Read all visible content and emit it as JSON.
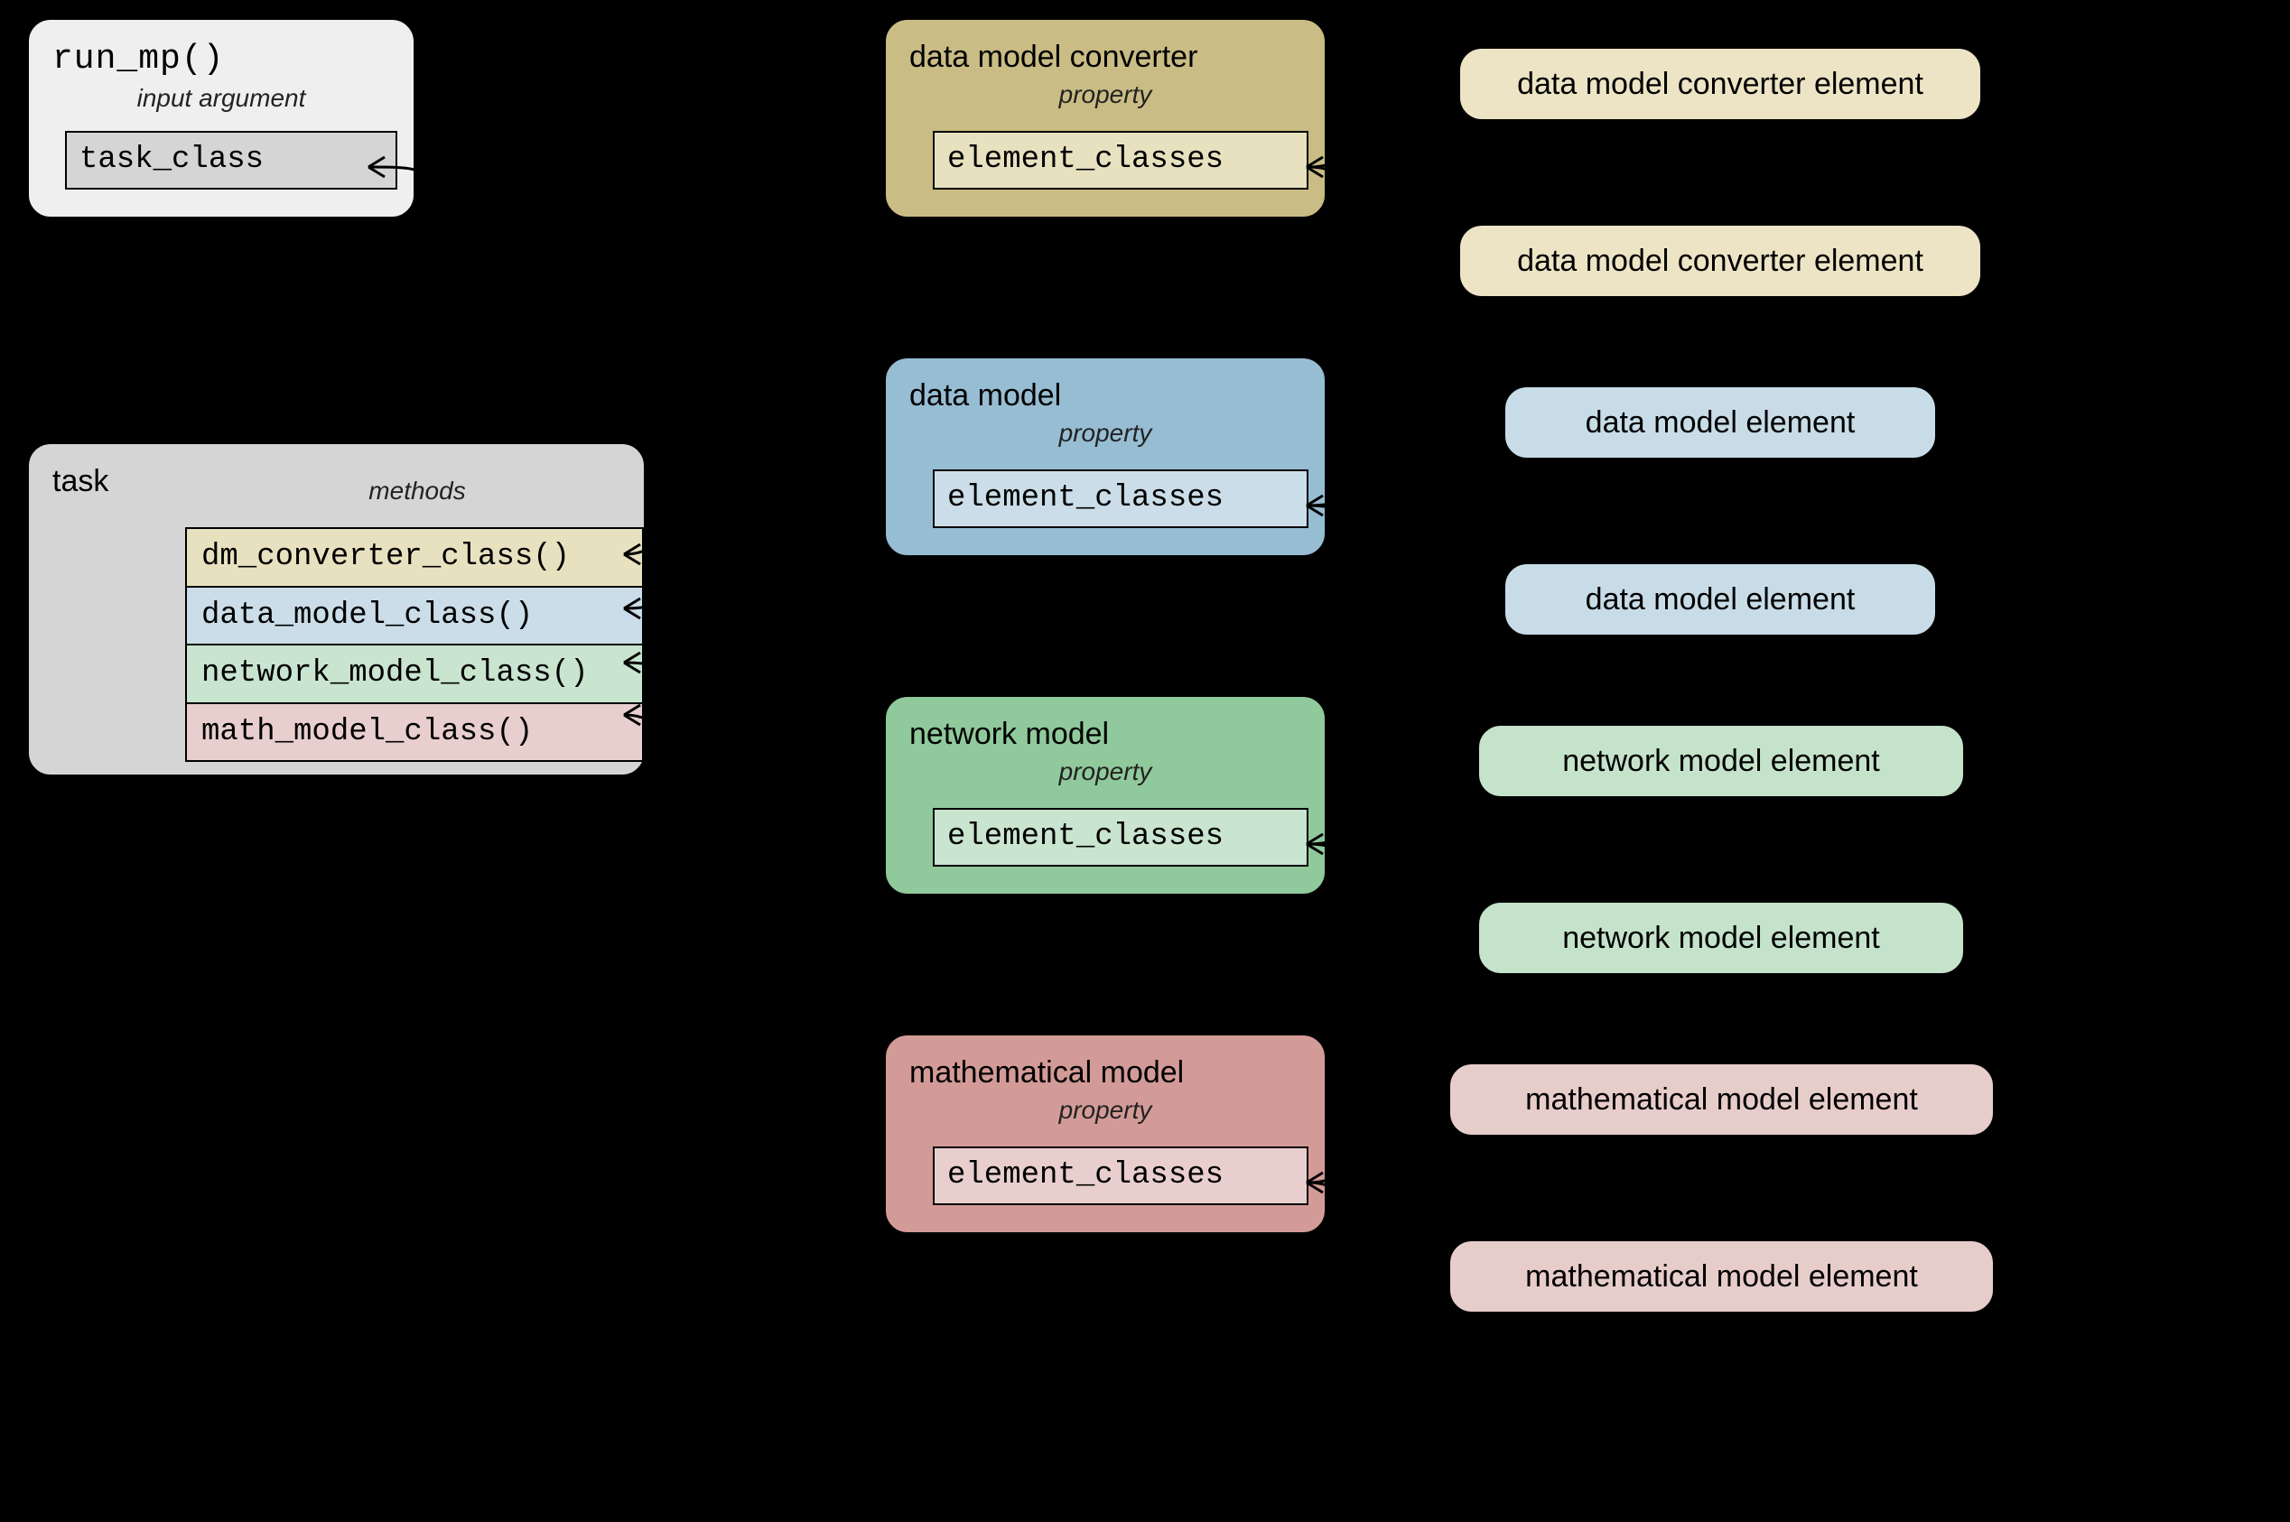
{
  "run_mp": {
    "title": "run_mp()",
    "subtitle": "input argument",
    "field": "task_class"
  },
  "task": {
    "title": "task",
    "subtitle": "methods",
    "methods": [
      {
        "label": "dm_converter_class()",
        "color": "tan"
      },
      {
        "label": "data_model_class()",
        "color": "blue"
      },
      {
        "label": "network_model_class()",
        "color": "green"
      },
      {
        "label": "math_model_class()",
        "color": "red"
      }
    ]
  },
  "middle": [
    {
      "title": "data model converter",
      "subtitle": "property",
      "field": "element_classes",
      "color": "tan"
    },
    {
      "title": "data model",
      "subtitle": "property",
      "field": "element_classes",
      "color": "blue"
    },
    {
      "title": "network model",
      "subtitle": "property",
      "field": "element_classes",
      "color": "green"
    },
    {
      "title": "mathematical model",
      "subtitle": "property",
      "field": "element_classes",
      "color": "red"
    }
  ],
  "right": [
    {
      "label": "data model converter element",
      "color": "tan"
    },
    {
      "label": "data model converter element",
      "color": "tan"
    },
    {
      "label": "data model element",
      "color": "blue"
    },
    {
      "label": "data model element",
      "color": "blue"
    },
    {
      "label": "network model element",
      "color": "green"
    },
    {
      "label": "network model element",
      "color": "green"
    },
    {
      "label": "mathematical model element",
      "color": "red"
    },
    {
      "label": "mathematical model element",
      "color": "red"
    }
  ]
}
